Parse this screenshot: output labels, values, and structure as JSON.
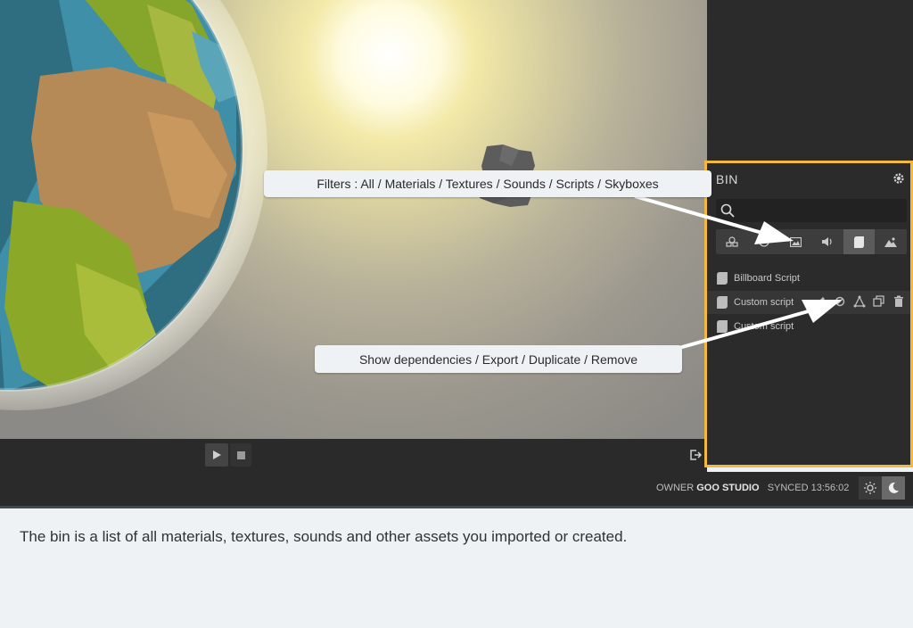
{
  "bin": {
    "title": "BIN",
    "search_placeholder": "",
    "filters": [
      {
        "name": "all",
        "icon": "all-assets-icon"
      },
      {
        "name": "materials",
        "icon": "material-sphere-icon"
      },
      {
        "name": "textures",
        "icon": "image-icon"
      },
      {
        "name": "sounds",
        "icon": "speaker-icon"
      },
      {
        "name": "scripts",
        "icon": "script-icon",
        "active": true
      },
      {
        "name": "skyboxes",
        "icon": "mountain-icon"
      }
    ],
    "assets": [
      {
        "label": "Billboard Script"
      },
      {
        "label": "Custom script"
      },
      {
        "label": "Custom script"
      }
    ],
    "row_actions": [
      "pencil-icon",
      "link-icon",
      "dependencies-icon",
      "duplicate-icon",
      "trash-icon"
    ]
  },
  "status": {
    "owner_label": "OWNER",
    "owner_name": "GOO STUDIO",
    "synced_label": "SYNCED",
    "synced_time": "13:56:02"
  },
  "callouts": {
    "filters": "Filters : All / Materials / Textures / Sounds / Scripts / Skyboxes",
    "actions": "Show dependencies / Export / Duplicate / Remove"
  },
  "caption": "The bin is a list of all materials, textures, sounds and other assets you imported or created.",
  "colors": {
    "highlight_border": "#f4b83d",
    "panel_bg": "#2b2b2b"
  }
}
